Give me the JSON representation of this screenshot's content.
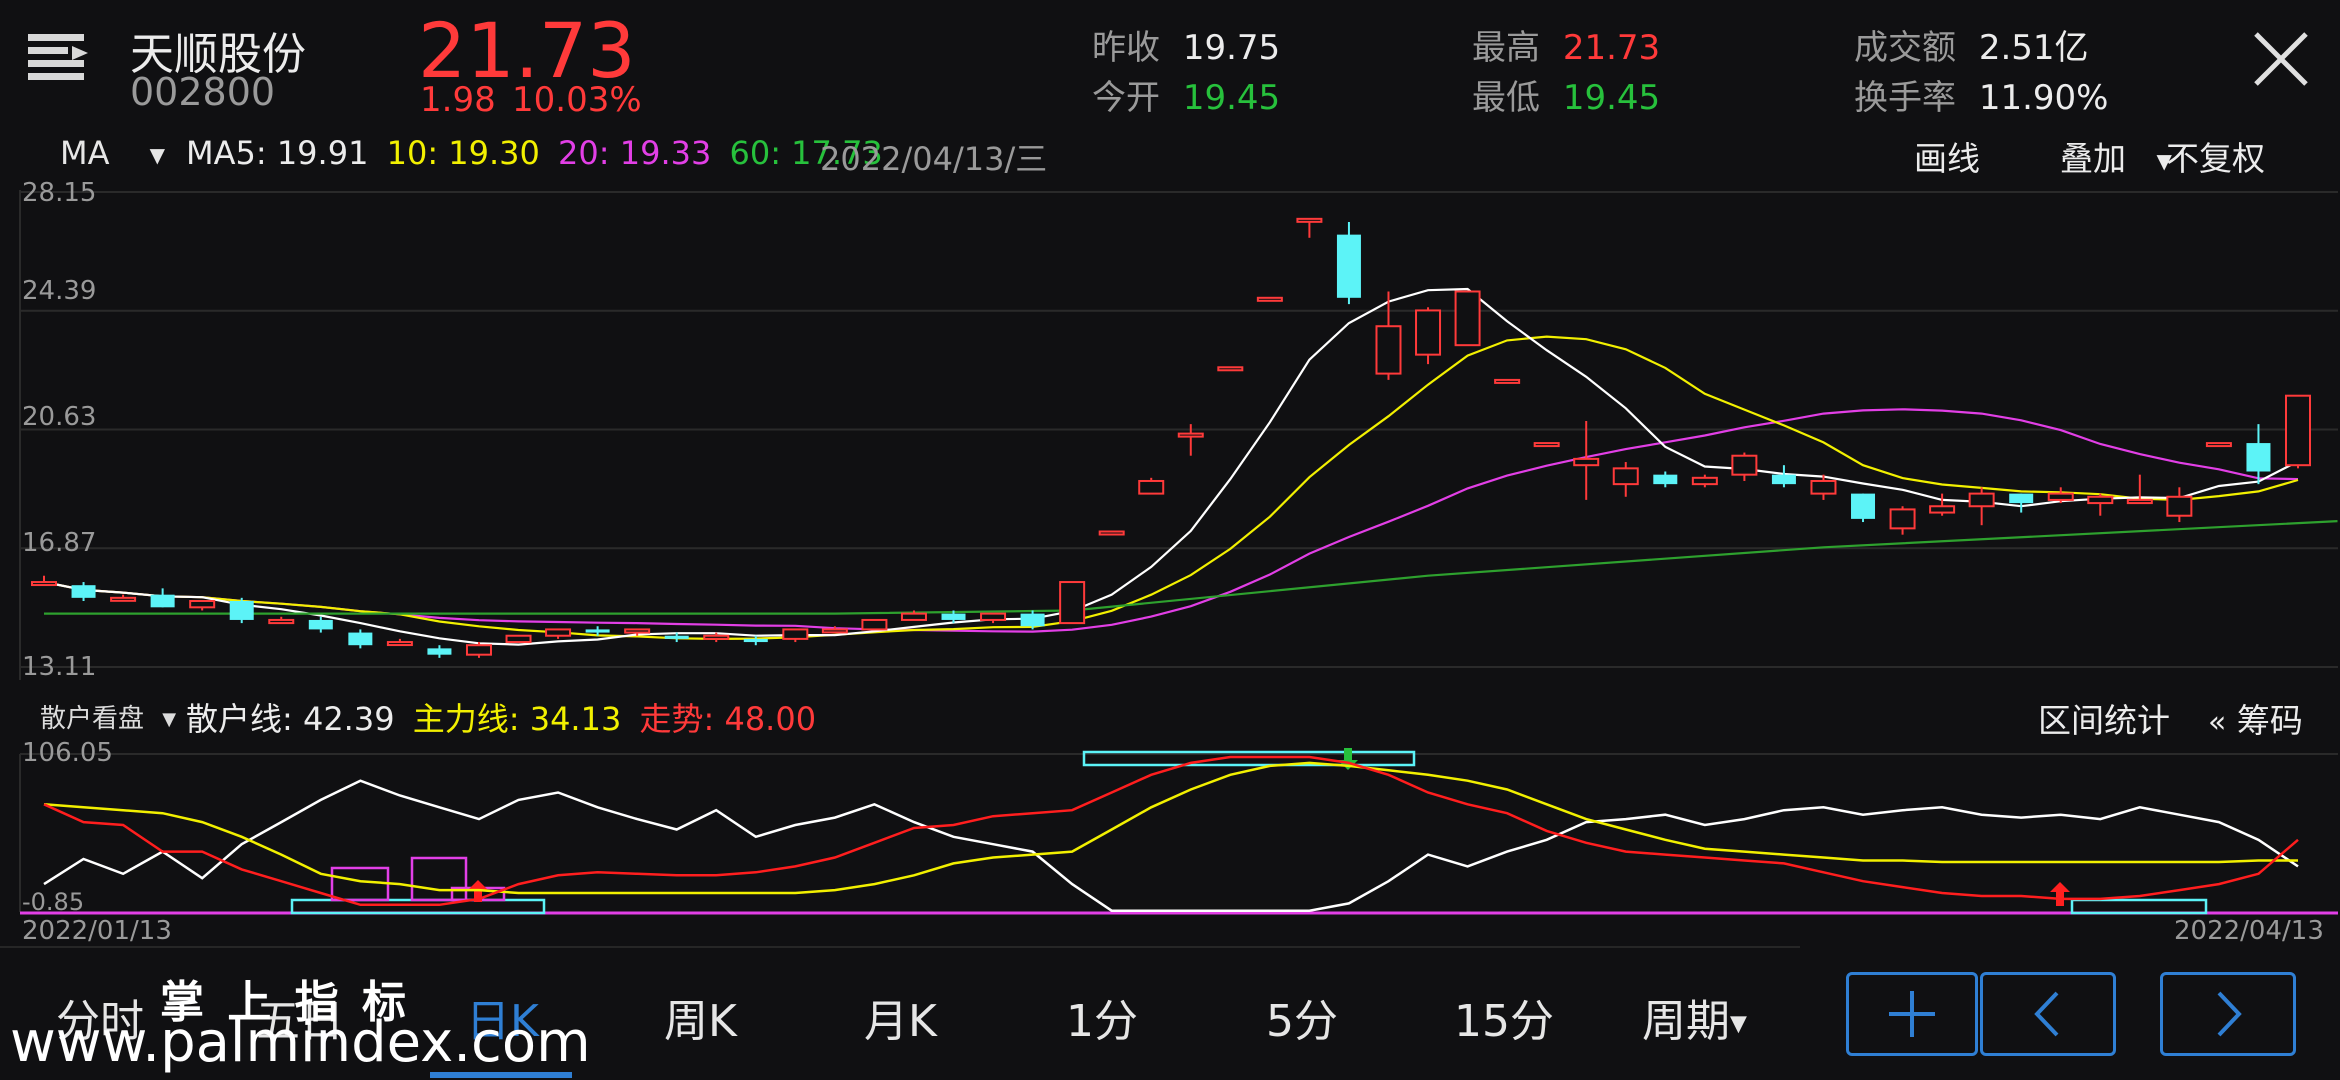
{
  "header": {
    "stock_name": "天顺股份",
    "stock_code": "002800",
    "price": "21.73",
    "change": "1.98",
    "change_pct": "10.03%",
    "stats": [
      {
        "label": "昨收",
        "value": "19.75",
        "color": "#ececec"
      },
      {
        "label": "今开",
        "value": "19.45",
        "color": "#27c13c"
      },
      {
        "label": "最高",
        "value": "21.73",
        "color": "#ff3a3a"
      },
      {
        "label": "最低",
        "value": "19.45",
        "color": "#27c13c"
      },
      {
        "label": "成交额",
        "value": "2.51亿",
        "color": "#ececec"
      },
      {
        "label": "换手率",
        "value": "11.90%",
        "color": "#ececec"
      }
    ]
  },
  "ma_bar": {
    "indicator": "MA",
    "ma5": "MA5: 19.91",
    "ma10": "10: 19.30",
    "ma20": "20: 19.33",
    "ma60": "60: 17.73",
    "date": "2022/04/13/三",
    "draw_line": "画线",
    "overlay": "叠加",
    "adjust": "不复权"
  },
  "price_axis": [
    "28.15",
    "24.39",
    "20.63",
    "16.87",
    "13.11"
  ],
  "sub_bar": {
    "indicator": "散户看盘",
    "retail_line": "散户线: 42.39",
    "main_line": "主力线: 34.13",
    "trend": "走势: 48.00",
    "range_stats": "区间统计",
    "chips": "筹码"
  },
  "sub_axis": [
    "106.05",
    "-0.85"
  ],
  "date_start": "2022/01/13",
  "date_end": "2022/04/13",
  "tabs": [
    "分时",
    "五日",
    "日K",
    "周K",
    "月K",
    "1分",
    "5分",
    "15分",
    "周期"
  ],
  "watermark": {
    "line1": "掌 上 指 标",
    "line2": "www.palmindex.com"
  },
  "colors": {
    "up": "#ff3a3a",
    "down": "#5cf3f7",
    "ma5": "#ffffff",
    "ma10": "#f2f000",
    "ma20": "#e23fe6",
    "ma60": "#2ea12e",
    "accent": "#2f7fd4"
  },
  "chart_data": {
    "type": "candlestick",
    "x_range": [
      "2022/01/13",
      "2022/04/13"
    ],
    "ylim": [
      13.11,
      28.15
    ],
    "candles": [
      {
        "o": 15.8,
        "h": 16.0,
        "l": 15.7,
        "c": 15.8
      },
      {
        "o": 15.7,
        "h": 15.8,
        "l": 15.2,
        "c": 15.3
      },
      {
        "o": 15.3,
        "h": 15.4,
        "l": 15.2,
        "c": 15.3
      },
      {
        "o": 15.4,
        "h": 15.6,
        "l": 15.0,
        "c": 15.0
      },
      {
        "o": 15.0,
        "h": 15.2,
        "l": 14.9,
        "c": 15.2
      },
      {
        "o": 15.2,
        "h": 15.3,
        "l": 14.5,
        "c": 14.6
      },
      {
        "o": 14.5,
        "h": 14.7,
        "l": 14.5,
        "c": 14.6
      },
      {
        "o": 14.6,
        "h": 14.7,
        "l": 14.2,
        "c": 14.3
      },
      {
        "o": 14.2,
        "h": 14.3,
        "l": 13.7,
        "c": 13.8
      },
      {
        "o": 13.9,
        "h": 14.0,
        "l": 13.8,
        "c": 13.9
      },
      {
        "o": 13.7,
        "h": 13.8,
        "l": 13.4,
        "c": 13.5
      },
      {
        "o": 13.5,
        "h": 13.9,
        "l": 13.4,
        "c": 13.8
      },
      {
        "o": 13.9,
        "h": 14.1,
        "l": 13.9,
        "c": 14.1
      },
      {
        "o": 14.1,
        "h": 14.3,
        "l": 14.0,
        "c": 14.3
      },
      {
        "o": 14.3,
        "h": 14.4,
        "l": 14.1,
        "c": 14.2
      },
      {
        "o": 14.2,
        "h": 14.3,
        "l": 14.1,
        "c": 14.3
      },
      {
        "o": 14.1,
        "h": 14.2,
        "l": 13.9,
        "c": 14.0
      },
      {
        "o": 14.0,
        "h": 14.2,
        "l": 13.9,
        "c": 14.1
      },
      {
        "o": 14.0,
        "h": 14.1,
        "l": 13.8,
        "c": 13.9
      },
      {
        "o": 14.0,
        "h": 14.3,
        "l": 13.9,
        "c": 14.3
      },
      {
        "o": 14.3,
        "h": 14.4,
        "l": 14.2,
        "c": 14.3
      },
      {
        "o": 14.3,
        "h": 14.6,
        "l": 14.3,
        "c": 14.6
      },
      {
        "o": 14.6,
        "h": 14.9,
        "l": 14.6,
        "c": 14.8
      },
      {
        "o": 14.8,
        "h": 14.9,
        "l": 14.5,
        "c": 14.6
      },
      {
        "o": 14.6,
        "h": 14.8,
        "l": 14.5,
        "c": 14.8
      },
      {
        "o": 14.8,
        "h": 14.9,
        "l": 14.3,
        "c": 14.4
      },
      {
        "o": 14.5,
        "h": 15.8,
        "l": 14.5,
        "c": 15.8
      },
      {
        "o": 17.4,
        "h": 17.4,
        "l": 17.4,
        "c": 17.4
      },
      {
        "o": 18.6,
        "h": 19.1,
        "l": 18.6,
        "c": 19.0
      },
      {
        "o": 20.5,
        "h": 20.8,
        "l": 19.8,
        "c": 20.5
      },
      {
        "o": 22.6,
        "h": 22.6,
        "l": 22.6,
        "c": 22.6
      },
      {
        "o": 24.8,
        "h": 24.8,
        "l": 24.8,
        "c": 24.8
      },
      {
        "o": 27.3,
        "h": 27.3,
        "l": 26.7,
        "c": 27.3
      },
      {
        "o": 26.8,
        "h": 27.2,
        "l": 24.6,
        "c": 24.8
      },
      {
        "o": 22.4,
        "h": 25.0,
        "l": 22.2,
        "c": 23.9
      },
      {
        "o": 23.0,
        "h": 24.5,
        "l": 22.7,
        "c": 24.4
      },
      {
        "o": 23.3,
        "h": 25.0,
        "l": 23.3,
        "c": 25.0
      },
      {
        "o": 22.2,
        "h": 22.2,
        "l": 22.2,
        "c": 22.2
      },
      {
        "o": 20.2,
        "h": 20.2,
        "l": 20.2,
        "c": 20.2
      },
      {
        "o": 19.5,
        "h": 20.9,
        "l": 18.4,
        "c": 19.7
      },
      {
        "o": 18.9,
        "h": 19.6,
        "l": 18.5,
        "c": 19.4
      },
      {
        "o": 19.2,
        "h": 19.3,
        "l": 18.8,
        "c": 18.9
      },
      {
        "o": 18.9,
        "h": 19.2,
        "l": 18.8,
        "c": 19.1
      },
      {
        "o": 19.2,
        "h": 19.9,
        "l": 19.0,
        "c": 19.8
      },
      {
        "o": 19.2,
        "h": 19.5,
        "l": 18.8,
        "c": 18.9
      },
      {
        "o": 18.6,
        "h": 19.2,
        "l": 18.4,
        "c": 19.0
      },
      {
        "o": 18.6,
        "h": 18.6,
        "l": 17.7,
        "c": 17.8
      },
      {
        "o": 17.5,
        "h": 18.2,
        "l": 17.3,
        "c": 18.1
      },
      {
        "o": 18.0,
        "h": 18.6,
        "l": 17.9,
        "c": 18.2
      },
      {
        "o": 18.2,
        "h": 18.8,
        "l": 17.6,
        "c": 18.6
      },
      {
        "o": 18.6,
        "h": 18.6,
        "l": 18.0,
        "c": 18.3
      },
      {
        "o": 18.4,
        "h": 18.8,
        "l": 18.3,
        "c": 18.6
      },
      {
        "o": 18.3,
        "h": 18.6,
        "l": 17.9,
        "c": 18.5
      },
      {
        "o": 18.3,
        "h": 19.2,
        "l": 18.3,
        "c": 18.4
      },
      {
        "o": 17.9,
        "h": 18.8,
        "l": 17.7,
        "c": 18.5
      },
      {
        "o": 20.2,
        "h": 20.2,
        "l": 20.2,
        "c": 20.2
      },
      {
        "o": 20.2,
        "h": 20.8,
        "l": 18.9,
        "c": 19.3
      },
      {
        "o": 19.5,
        "h": 21.7,
        "l": 19.4,
        "c": 21.7
      }
    ],
    "ma60": [
      [
        0,
        14.8
      ],
      [
        10,
        14.8
      ],
      [
        20,
        14.8
      ],
      [
        26,
        14.9
      ],
      [
        35,
        16.0
      ],
      [
        45,
        16.9
      ],
      [
        58,
        17.73
      ]
    ],
    "sub_ylim": [
      -0.85,
      106.05
    ]
  }
}
